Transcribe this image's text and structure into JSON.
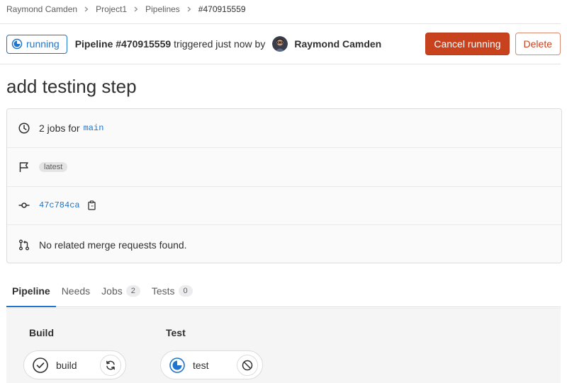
{
  "breadcrumb": [
    "Raymond Camden",
    "Project1",
    "Pipelines",
    "#470915559"
  ],
  "status": {
    "label": "running",
    "color": "#1f75cb"
  },
  "pipeline": {
    "id_label": "Pipeline #470915559",
    "trigger_text": "triggered just now by",
    "author": "Raymond Camden"
  },
  "actions": {
    "cancel": "Cancel running",
    "delete": "Delete"
  },
  "commit_title": "add testing step",
  "info": {
    "jobs_text": "2 jobs for",
    "ref": "main",
    "tag": "latest",
    "sha": "47c784ca",
    "merge_text": "No related merge requests found."
  },
  "tabs": [
    {
      "label": "Pipeline",
      "count": null,
      "active": true
    },
    {
      "label": "Needs",
      "count": null,
      "active": false
    },
    {
      "label": "Jobs",
      "count": "2",
      "active": false
    },
    {
      "label": "Tests",
      "count": "0",
      "active": false
    }
  ],
  "stages": [
    {
      "title": "Build",
      "job": "build",
      "job_status": "success",
      "action": "retry"
    },
    {
      "title": "Test",
      "job": "test",
      "job_status": "running",
      "action": "cancel"
    }
  ],
  "colors": {
    "accent": "#1f75cb",
    "danger": "#c9421e",
    "success": "#303030"
  },
  "icons": [
    "running-icon",
    "clock-icon",
    "flag-icon",
    "commit-icon",
    "copy-icon",
    "merge-request-icon",
    "check-circle-icon",
    "retry-icon",
    "cancel-icon"
  ]
}
